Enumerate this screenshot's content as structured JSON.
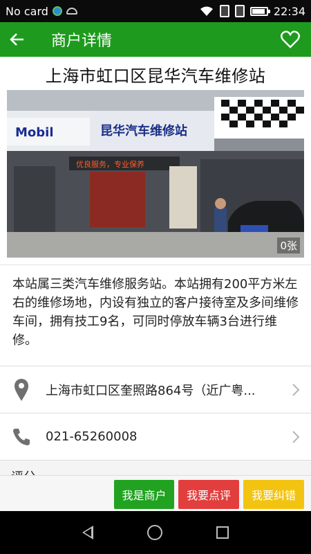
{
  "status_bar": {
    "carrier": "No card",
    "time": "22:34"
  },
  "app_bar": {
    "title": "商户详情",
    "back_icon": "arrow-left-icon",
    "favorite_icon": "heart-outline-icon"
  },
  "shop": {
    "name": "上海市虹口区昆华汽车维修站",
    "photo_count": "0张",
    "description": "本站属三类汽车维修服务站。本站拥有200平方米左右的维修场地，内设有独立的客户接待室及多间维修车间，拥有技工9名，可同时停放车辆3台进行维修。",
    "address": "上海市虹口区奎照路864号（近广粤...",
    "phone": "021-65260008",
    "sign_left": "Mobil",
    "sign_mid": "昆华汽车维修站",
    "sign_led": "优良服务，专业保养"
  },
  "sections": {
    "rating_header": "评分"
  },
  "actions": {
    "merchant": "我是商户",
    "review": "我要点评",
    "correct": "我要纠错"
  },
  "colors": {
    "primary": "#1e9b1e",
    "merchant_btn": "#21a321",
    "review_btn": "#e23e3e",
    "correct_btn": "#f3c312"
  }
}
